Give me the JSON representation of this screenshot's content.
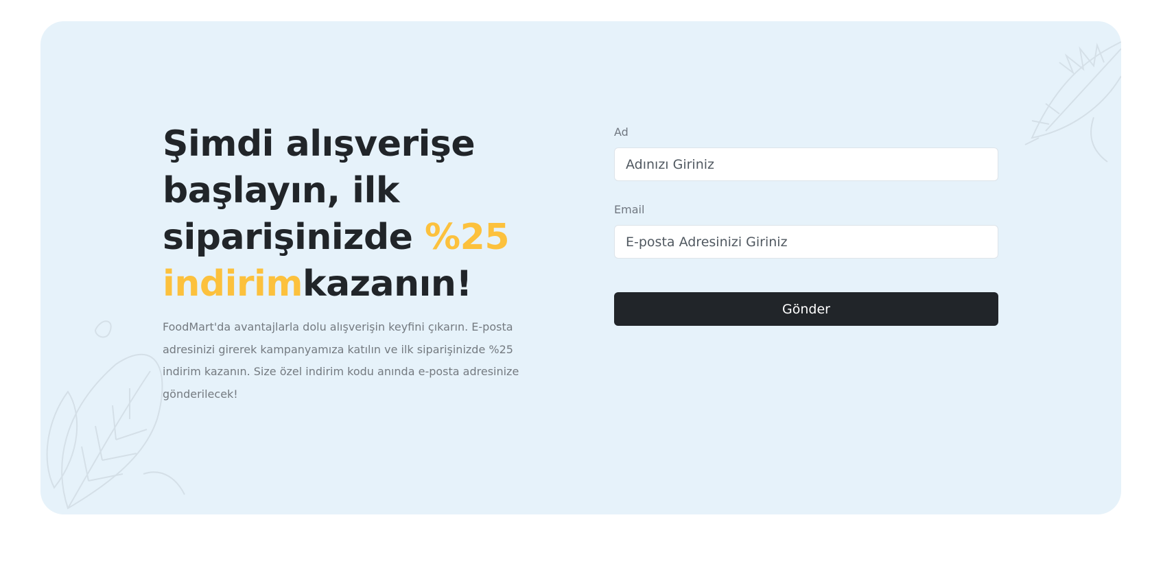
{
  "headline": {
    "part1": "Şimdi alışverişe başlayın, ilk siparişinizde ",
    "highlight": "%25 indirim",
    "part2": "kazanın!"
  },
  "intro_text": "FoodMart'da avantajlarla dolu alışverişin keyfini çıkarın. E-posta adresinizi girerek kampanyamıza katılın ve ilk siparişinizde %25 indirim kazanın. Size özel indirim kodu anında e-posta adresinize gönderilecek!",
  "form": {
    "name_label": "Ad",
    "name_placeholder": "Adınızı Giriniz",
    "name_value": "",
    "email_label": "Email",
    "email_placeholder": "E-posta Adresinizi Giriniz",
    "email_value": "",
    "submit_label": "Gönder"
  },
  "colors": {
    "banner_bg": "#e6f2fa",
    "accent": "#fcc13d",
    "heading": "#212529",
    "button_bg": "#212529",
    "body_text": "#747a80"
  },
  "icons": {
    "decor_left": "leaf-sketch-icon",
    "decor_right": "leaf-sketch-icon"
  }
}
